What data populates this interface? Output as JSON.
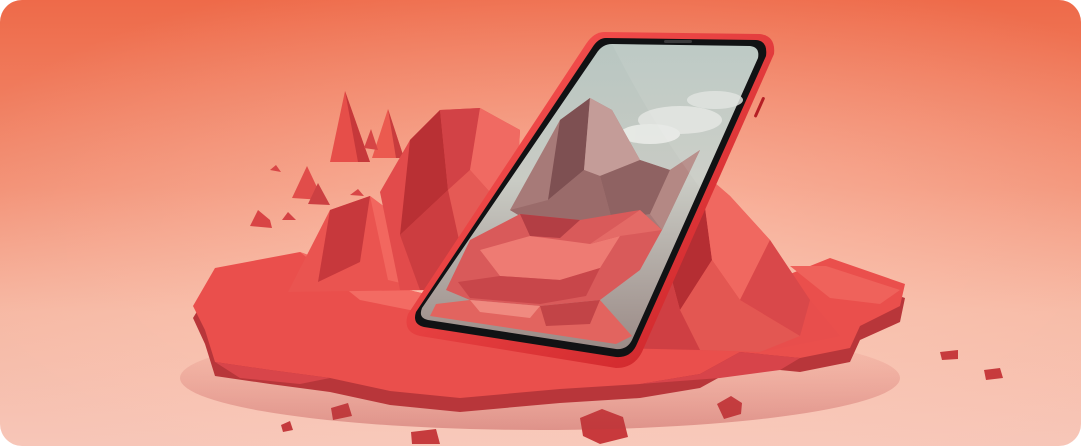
{
  "image": {
    "subject": "smartphone-with-lowpoly-mountain-diorama",
    "icon_names": [
      "phone-illustration",
      "mountain-illustration",
      "rock-illustration"
    ],
    "colors": {
      "background_top": "#ef6a4a",
      "background_bottom": "#f8c8b8",
      "terrain": "#e94a48",
      "terrain_dark": "#b92f34",
      "phone_frame": "#d92d2e",
      "screen_sky": "#b9c2bc",
      "screen_mountain": "#9a6b6b"
    }
  }
}
